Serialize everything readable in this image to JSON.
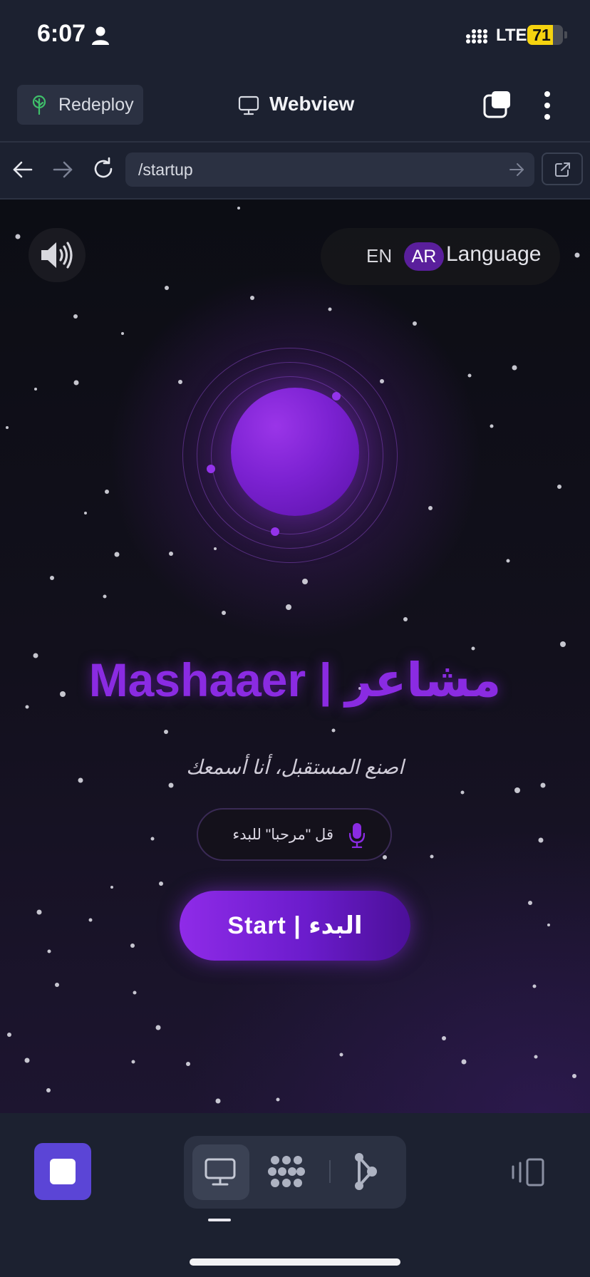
{
  "status_bar": {
    "time": "6:07",
    "network": "LTE",
    "battery": "71"
  },
  "app_bar": {
    "redeploy_label": "Redeploy",
    "title": "Webview"
  },
  "url_bar": {
    "url": "/startup"
  },
  "page": {
    "lang_en": "EN",
    "lang_ar": "AR",
    "lang_label": "Language",
    "title": "Mashaaer | مشاعر",
    "subtitle": "اصنع المستقبل، أنا أسمعك",
    "voice_hint": "قل \"مرحبا\" للبدء",
    "start_label": "Start | البدء"
  },
  "colors": {
    "accent_purple": "#8a2be2",
    "stop_button": "#5b45d6",
    "battery": "#f5d30f",
    "background": "#1c2130"
  },
  "icons": {
    "status": [
      "person-icon",
      "signal-icon"
    ],
    "app_bar": [
      "tree-icon",
      "monitor-icon",
      "tabs-icon",
      "kebab-icon"
    ],
    "url_bar": [
      "back-arrow-icon",
      "forward-arrow-icon",
      "reload-icon",
      "go-arrow-icon",
      "external-link-icon"
    ],
    "page": [
      "speaker-icon",
      "mic-icon"
    ],
    "bottom": [
      "stop-icon",
      "monitor-icon",
      "graph-icon",
      "flow-icon",
      "layout-icon"
    ]
  }
}
